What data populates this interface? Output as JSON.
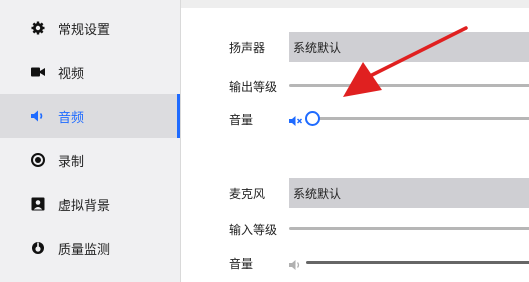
{
  "sidebar": {
    "items": [
      {
        "label": "常规设置",
        "icon": "gear-icon"
      },
      {
        "label": "视频",
        "icon": "video-camera-icon"
      },
      {
        "label": "音频",
        "icon": "speaker-icon",
        "active": true
      },
      {
        "label": "录制",
        "icon": "record-icon"
      },
      {
        "label": "虚拟背景",
        "icon": "portrait-icon"
      },
      {
        "label": "质量监测",
        "icon": "monitor-gauge-icon"
      }
    ]
  },
  "speaker": {
    "label": "扬声器",
    "device": "系统默认",
    "output_level_label": "输出等级",
    "volume_label": "音量",
    "muted": true,
    "volume_level": 0
  },
  "microphone": {
    "label": "麦克风",
    "device": "系统默认",
    "input_level_label": "输入等级",
    "volume_label": "音量"
  },
  "colors": {
    "accent": "#1f6bff",
    "annotation_arrow": "#e02020"
  }
}
